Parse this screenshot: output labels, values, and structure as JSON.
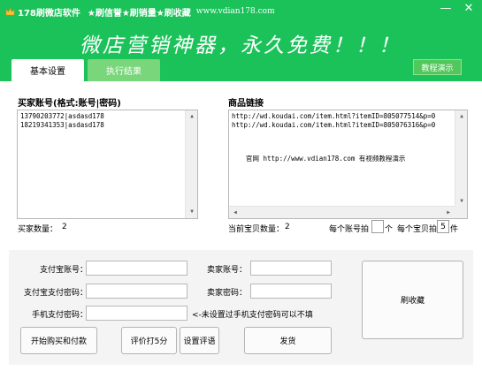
{
  "window": {
    "app_name": "178刷微店软件",
    "features": "★刷信誉★刷销量★刷收藏",
    "site": "www.vdian178.com",
    "slogan": "微店营销神器，永久免费！！！",
    "minimize": "—",
    "close": "✕"
  },
  "tabs": [
    {
      "label": "基本设置",
      "active": true
    },
    {
      "label": "执行结果",
      "active": false
    }
  ],
  "tutorial_button": "教程演示",
  "buyer": {
    "label": "买家账号(格式:账号|密码)",
    "lines": [
      "13790203772|asdasd178",
      "18219341353|asdasd178"
    ],
    "count_label": "买家数量：",
    "count": "2"
  },
  "product": {
    "label": "商品链接",
    "lines": [
      "http://wd.koudai.com/item.html?itemID=805077514&p=0",
      "http://wd.koudai.com/item.html?itemID=805076316&p=0"
    ],
    "notice": "官网 http://www.vdian178.com  有视频教程演示",
    "count_label": "当前宝贝数量：",
    "count": "2",
    "per_account_label": "每个账号拍",
    "per_account_value": "",
    "per_account_unit": "个",
    "per_item_label": "每个宝贝拍",
    "per_item_value": "5",
    "per_item_unit": "件"
  },
  "form": {
    "alipay_account_label": "支付宝账号：",
    "alipay_account_value": "",
    "alipay_password_label": "支付宝支付密码：",
    "alipay_password_value": "",
    "phone_password_label": "手机支付密码：",
    "phone_password_value": "",
    "phone_hint": "<-未设置过手机支付密码可以不填",
    "seller_account_label": "卖家账号：",
    "seller_account_value": "",
    "seller_password_label": "卖家密码：",
    "seller_password_value": ""
  },
  "buttons": {
    "favorite": "刷收藏",
    "start_purchase": "开始购买和付款",
    "rate": "评价打5分",
    "set_review": "设置评语",
    "ship": "发货"
  },
  "colors": {
    "header_green": "#1bc25a",
    "tab_inactive": "#79d67a"
  }
}
